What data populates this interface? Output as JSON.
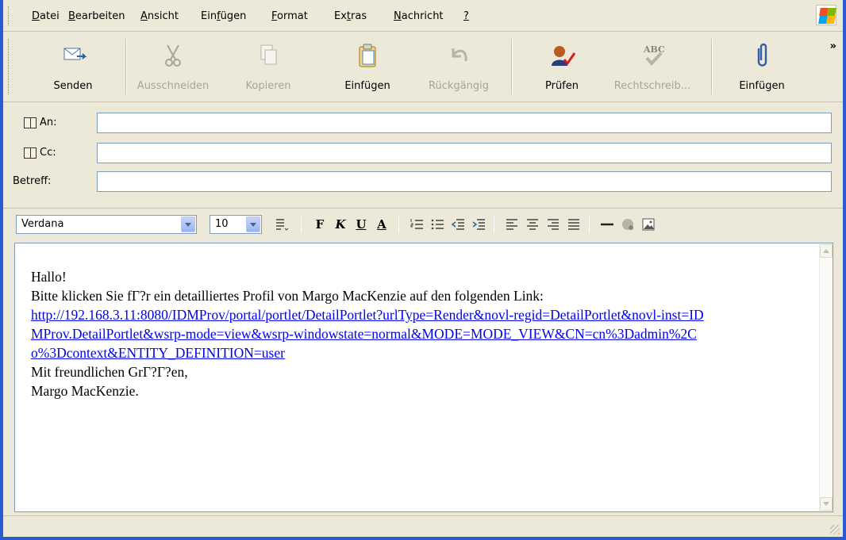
{
  "menu": [
    "Datei",
    "Bearbeiten",
    "Ansicht",
    "Einfügen",
    "Format",
    "Extras",
    "Nachricht",
    "?"
  ],
  "menu_hotkeys": [
    "D",
    "B",
    "A",
    "f",
    "F",
    "t",
    "N",
    "?"
  ],
  "toolbar": {
    "send": "Senden",
    "cut": "Ausschneiden",
    "copy": "Kopieren",
    "paste": "Einfügen",
    "undo": "Rückgängig",
    "check": "Prüfen",
    "spelling": "Rechtschreib...",
    "attach": "Einfügen",
    "overflow": "»"
  },
  "fields": {
    "to_label": "An:",
    "cc_label": "Cc:",
    "subject_label": "Betreff:",
    "to_value": "",
    "cc_value": "",
    "subject_value": ""
  },
  "format": {
    "font": "Verdana",
    "size": "10",
    "bold": "F",
    "italic": "K",
    "underline": "U",
    "color": "A"
  },
  "body": {
    "line1": "Hallo!",
    "line2": "Bitte klicken Sie fΓ?r ein detailliertes Profil von Margo MacKenzie auf den folgenden Link:",
    "link": "http://192.168.3.11:8080/IDMProv/portal/portlet/DetailPortlet?urlType=Render&novl-regid=DetailPortlet&novl-inst=IDMProv.DetailPortlet&wsrp-mode=view&wsrp-windowstate=normal&MODE=MODE_VIEW&CN=cn%3Dadmin%2Co%3Dcontext&ENTITY_DEFINITION=user",
    "line3": "Mit freundlichen GrΓ?Γ?en,",
    "line4": "Margo MacKenzie."
  },
  "icons": {
    "send": "send-mail-icon",
    "cut": "scissors-icon",
    "copy": "copy-icon",
    "paste": "clipboard-icon",
    "undo": "undo-icon",
    "check": "check-names-icon",
    "spelling": "spellcheck-icon",
    "attach": "paperclip-icon"
  },
  "colors": {
    "link": "#0000ee",
    "frame": "#2a5bd7",
    "chrome": "#ece9d8",
    "disabled_text": "#a8a596"
  }
}
